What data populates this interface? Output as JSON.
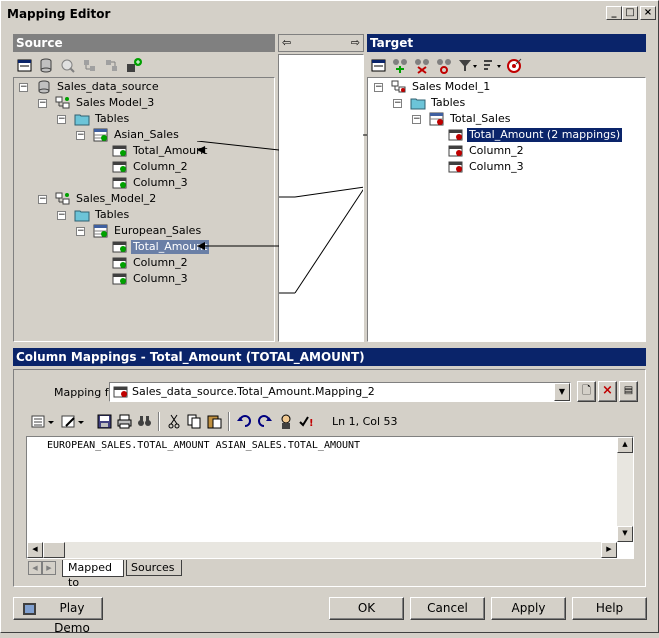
{
  "window": {
    "title": "Mapping Editor"
  },
  "source": {
    "header": "Source",
    "tree": [
      {
        "label": "Sales_data_source"
      },
      {
        "label": "Sales Model_3"
      },
      {
        "label": "Tables"
      },
      {
        "label": "Asian_Sales"
      },
      {
        "label": "Total_Amount"
      },
      {
        "label": "Column_2"
      },
      {
        "label": "Column_3"
      },
      {
        "label": "Sales_Model_2"
      },
      {
        "label": "Tables"
      },
      {
        "label": "European_Sales"
      },
      {
        "label": "Total_Amount"
      },
      {
        "label": "Column_2"
      },
      {
        "label": "Column_3"
      }
    ]
  },
  "target": {
    "header": "Target",
    "tree": [
      {
        "label": "Sales Model_1"
      },
      {
        "label": "Tables"
      },
      {
        "label": "Total_Sales"
      },
      {
        "label": "Total_Amount (2 mappings)"
      },
      {
        "label": "Column_2"
      },
      {
        "label": "Column_3"
      }
    ]
  },
  "middle": {
    "left_arrow": "⇦",
    "right_arrow": "⇨"
  },
  "mappings": {
    "header": "Column Mappings - Total_Amount (TOTAL_AMOUNT)",
    "mapping_for_label": "Mapping for:",
    "mapping_for_value": "Sales_data_source.Total_Amount.Mapping_2",
    "status": "Ln 1, Col 53",
    "editor_text": "EUROPEAN_SALES.TOTAL_AMOUNT ASIAN_SALES.TOTAL_AMOUNT",
    "tabs": [
      "Mapped to",
      "Sources"
    ]
  },
  "buttons": {
    "play_demo": "Play Demo",
    "ok": "OK",
    "cancel": "Cancel",
    "apply": "Apply",
    "help": "Help"
  },
  "colors": {
    "header_active": "#0a246a",
    "header_inactive": "#808080",
    "face": "#d4d0c8"
  }
}
